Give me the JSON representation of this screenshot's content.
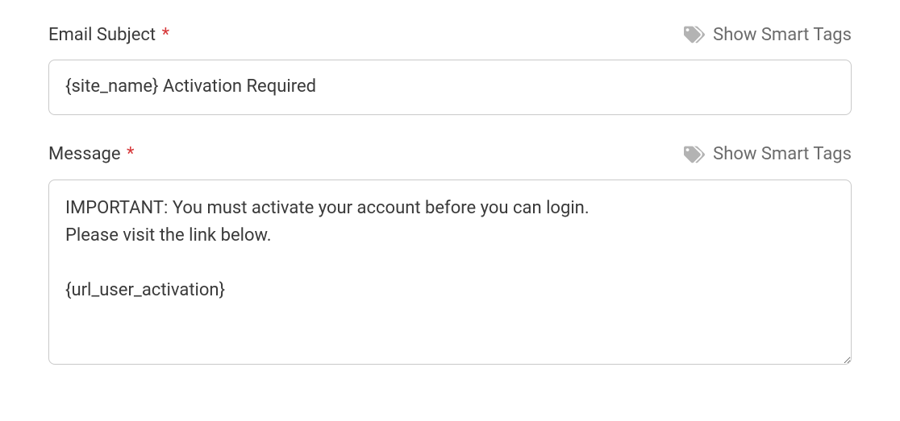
{
  "fields": {
    "email_subject": {
      "label": "Email Subject",
      "value": "{site_name} Activation Required",
      "smart_tags_label": "Show Smart Tags"
    },
    "message": {
      "label": "Message",
      "value": "IMPORTANT: You must activate your account before you can login.\nPlease visit the link below.\n\n{url_user_activation}",
      "smart_tags_label": "Show Smart Tags"
    }
  }
}
